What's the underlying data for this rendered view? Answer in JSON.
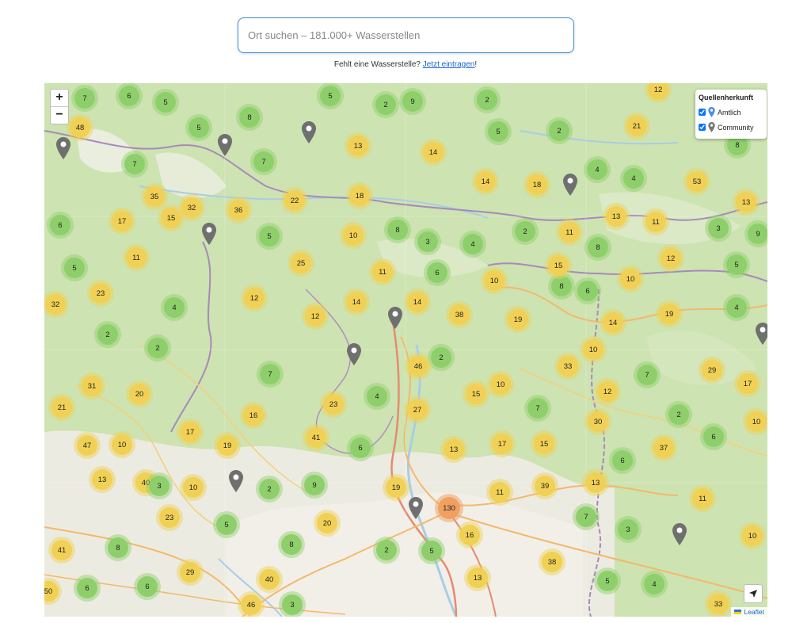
{
  "search": {
    "placeholder": "Ort suchen – 181.000+ Wasserstellen"
  },
  "hint": {
    "text": "Fehlt eine Wasserstelle? ",
    "link": "Jetzt eintragen",
    "suffix": "!"
  },
  "zoom": {
    "in": "+",
    "out": "−"
  },
  "legend": {
    "title": "Quellenherkunft",
    "items": [
      {
        "label": "Amtlich",
        "checked": true,
        "color": "#4a90e2"
      },
      {
        "label": "Community",
        "checked": true,
        "color": "#777777"
      }
    ]
  },
  "attribution": {
    "label": "Leaflet"
  },
  "colors": {
    "green": "#8fcf6b",
    "yellow": "#f0d155",
    "orange": "#f0a060",
    "accent": "#3b8fd9"
  },
  "clusters": [
    {
      "n": "7",
      "c": "green"
    },
    {
      "n": "6",
      "c": "green"
    },
    {
      "n": "5",
      "c": "green"
    },
    {
      "n": "5",
      "c": "green"
    },
    {
      "n": "2",
      "c": "green"
    },
    {
      "n": "9",
      "c": "green"
    },
    {
      "n": "2",
      "c": "green"
    },
    {
      "n": "12",
      "c": "yellow"
    },
    {
      "n": "48",
      "c": "yellow"
    },
    {
      "n": "8",
      "c": "green"
    },
    {
      "n": "5",
      "c": "green"
    },
    {
      "n": "5",
      "c": "green"
    },
    {
      "n": "2",
      "c": "green"
    },
    {
      "n": "21",
      "c": "yellow"
    },
    {
      "n": "13",
      "c": "yellow"
    },
    {
      "n": "14",
      "c": "yellow"
    },
    {
      "n": "8",
      "c": "green"
    },
    {
      "n": "7",
      "c": "green"
    },
    {
      "n": "7",
      "c": "green"
    },
    {
      "n": "4",
      "c": "green"
    },
    {
      "n": "14",
      "c": "yellow"
    },
    {
      "n": "18",
      "c": "yellow"
    },
    {
      "n": "4",
      "c": "green"
    },
    {
      "n": "53",
      "c": "yellow"
    },
    {
      "n": "35",
      "c": "yellow"
    },
    {
      "n": "22",
      "c": "yellow"
    },
    {
      "n": "18",
      "c": "yellow"
    },
    {
      "n": "13",
      "c": "yellow"
    },
    {
      "n": "17",
      "c": "yellow"
    },
    {
      "n": "15",
      "c": "yellow"
    },
    {
      "n": "32",
      "c": "yellow"
    },
    {
      "n": "36",
      "c": "yellow"
    },
    {
      "n": "13",
      "c": "yellow"
    },
    {
      "n": "11",
      "c": "yellow"
    },
    {
      "n": "6",
      "c": "green"
    },
    {
      "n": "5",
      "c": "green"
    },
    {
      "n": "10",
      "c": "yellow"
    },
    {
      "n": "8",
      "c": "green"
    },
    {
      "n": "3",
      "c": "green"
    },
    {
      "n": "4",
      "c": "green"
    },
    {
      "n": "2",
      "c": "green"
    },
    {
      "n": "11",
      "c": "yellow"
    },
    {
      "n": "3",
      "c": "green"
    },
    {
      "n": "9",
      "c": "green"
    },
    {
      "n": "11",
      "c": "yellow"
    },
    {
      "n": "25",
      "c": "yellow"
    },
    {
      "n": "8",
      "c": "green"
    },
    {
      "n": "12",
      "c": "yellow"
    },
    {
      "n": "5",
      "c": "green"
    },
    {
      "n": "5",
      "c": "green"
    },
    {
      "n": "6",
      "c": "green"
    },
    {
      "n": "11",
      "c": "yellow"
    },
    {
      "n": "8",
      "c": "green"
    },
    {
      "n": "10",
      "c": "yellow"
    },
    {
      "n": "15",
      "c": "yellow"
    },
    {
      "n": "10",
      "c": "yellow"
    },
    {
      "n": "23",
      "c": "yellow"
    },
    {
      "n": "6",
      "c": "green"
    },
    {
      "n": "12",
      "c": "yellow"
    },
    {
      "n": "32",
      "c": "yellow"
    },
    {
      "n": "4",
      "c": "green"
    },
    {
      "n": "14",
      "c": "yellow"
    },
    {
      "n": "14",
      "c": "yellow"
    },
    {
      "n": "38",
      "c": "yellow"
    },
    {
      "n": "12",
      "c": "yellow"
    },
    {
      "n": "19",
      "c": "yellow"
    },
    {
      "n": "14",
      "c": "yellow"
    },
    {
      "n": "19",
      "c": "yellow"
    },
    {
      "n": "4",
      "c": "green"
    },
    {
      "n": "2",
      "c": "green"
    },
    {
      "n": "2",
      "c": "green"
    },
    {
      "n": "10",
      "c": "yellow"
    },
    {
      "n": "2",
      "c": "green"
    },
    {
      "n": "46",
      "c": "yellow"
    },
    {
      "n": "33",
      "c": "yellow"
    },
    {
      "n": "7",
      "c": "green"
    },
    {
      "n": "29",
      "c": "yellow"
    },
    {
      "n": "7",
      "c": "green"
    },
    {
      "n": "31",
      "c": "yellow"
    },
    {
      "n": "20",
      "c": "yellow"
    },
    {
      "n": "4",
      "c": "green"
    },
    {
      "n": "15",
      "c": "yellow"
    },
    {
      "n": "10",
      "c": "yellow"
    },
    {
      "n": "12",
      "c": "yellow"
    },
    {
      "n": "17",
      "c": "yellow"
    },
    {
      "n": "21",
      "c": "yellow"
    },
    {
      "n": "16",
      "c": "yellow"
    },
    {
      "n": "23",
      "c": "yellow"
    },
    {
      "n": "27",
      "c": "yellow"
    },
    {
      "n": "7",
      "c": "green"
    },
    {
      "n": "2",
      "c": "green"
    },
    {
      "n": "10",
      "c": "yellow"
    },
    {
      "n": "17",
      "c": "yellow"
    },
    {
      "n": "41",
      "c": "yellow"
    },
    {
      "n": "19",
      "c": "yellow"
    },
    {
      "n": "30",
      "c": "yellow"
    },
    {
      "n": "47",
      "c": "yellow"
    },
    {
      "n": "10",
      "c": "yellow"
    },
    {
      "n": "6",
      "c": "green"
    },
    {
      "n": "13",
      "c": "yellow"
    },
    {
      "n": "17",
      "c": "yellow"
    },
    {
      "n": "15",
      "c": "yellow"
    },
    {
      "n": "37",
      "c": "yellow"
    },
    {
      "n": "6",
      "c": "green"
    },
    {
      "n": "13",
      "c": "yellow"
    },
    {
      "n": "40",
      "c": "yellow"
    },
    {
      "n": "3",
      "c": "green"
    },
    {
      "n": "10",
      "c": "yellow"
    },
    {
      "n": "2",
      "c": "green"
    },
    {
      "n": "9",
      "c": "green"
    },
    {
      "n": "19",
      "c": "yellow"
    },
    {
      "n": "11",
      "c": "yellow"
    },
    {
      "n": "39",
      "c": "yellow"
    },
    {
      "n": "13",
      "c": "yellow"
    },
    {
      "n": "6",
      "c": "green"
    },
    {
      "n": "11",
      "c": "yellow"
    },
    {
      "n": "130",
      "c": "orange"
    },
    {
      "n": "10",
      "c": "yellow"
    },
    {
      "n": "23",
      "c": "yellow"
    },
    {
      "n": "5",
      "c": "green"
    },
    {
      "n": "20",
      "c": "yellow"
    },
    {
      "n": "7",
      "c": "green"
    },
    {
      "n": "3",
      "c": "green"
    },
    {
      "n": "16",
      "c": "yellow"
    },
    {
      "n": "41",
      "c": "yellow"
    },
    {
      "n": "8",
      "c": "green"
    },
    {
      "n": "8",
      "c": "green"
    },
    {
      "n": "2",
      "c": "green"
    },
    {
      "n": "5",
      "c": "green"
    },
    {
      "n": "6",
      "c": "green"
    },
    {
      "n": "38",
      "c": "yellow"
    },
    {
      "n": "6",
      "c": "green"
    },
    {
      "n": "29",
      "c": "yellow"
    },
    {
      "n": "40",
      "c": "yellow"
    },
    {
      "n": "13",
      "c": "yellow"
    },
    {
      "n": "5",
      "c": "green"
    },
    {
      "n": "4",
      "c": "green"
    },
    {
      "n": "46",
      "c": "yellow"
    },
    {
      "n": "3",
      "c": "green"
    },
    {
      "n": "33",
      "c": "yellow"
    },
    {
      "n": "50",
      "c": "yellow"
    },
    {
      "n": "11",
      "c": "yellow"
    },
    {
      "n": "2",
      "c": "green"
    }
  ]
}
